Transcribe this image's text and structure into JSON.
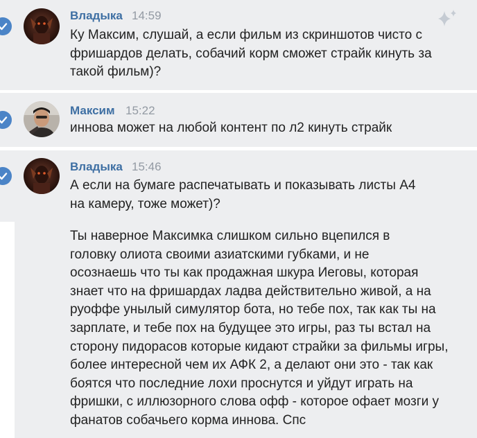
{
  "messages": [
    {
      "author": "Владыка",
      "time": "14:59",
      "lines": [
        "Ку Максим, слушай, а если фильм из скриншотов чисто с",
        "фришардов делать, собачий корм сможет страйк кинуть за",
        "такой фильм)?"
      ]
    },
    {
      "author": "Максим",
      "time": "15:22",
      "lines": [
        "иннова может на любой контент по л2 кинуть страйк"
      ]
    },
    {
      "author": "Владыка",
      "time": "15:46",
      "lines": [
        "А если на бумаге распечатывать и показывать листы А4",
        "на камеру, тоже может)?"
      ]
    }
  ],
  "continuation": {
    "lines": [
      "Ты наверное Максимка слишком сильно вцепился в",
      "головку олиота своими азиатскими губками, и не",
      "осознаешь что ты как продажная шкура Иеговы, которая",
      "знает что на фришардах ладва действительно живой, а на",
      "руоффе унылый симулятор бота, но тебе пох, так как ты на",
      "зарплате, и тебе пох на будущее это игры, раз ты встал на",
      "сторону пидорасов которые кидают страйки за фильмы игры,",
      "более интересной чем их АФК 2, а делают они это - так как",
      "боятся что последние лохи проснутся и уйдут играть на",
      "фришки, с иллюзорного слова офф - которое офает мозги у",
      "фанатов собачьего корма иннова. Спс"
    ]
  },
  "colors": {
    "accent": "#3e6fa3",
    "check": "#4b84c7",
    "bubble_bg": "#edeef0",
    "time": "#939aa3",
    "text": "#222222"
  },
  "icons": [
    "check-icon",
    "sparkle-icon"
  ]
}
